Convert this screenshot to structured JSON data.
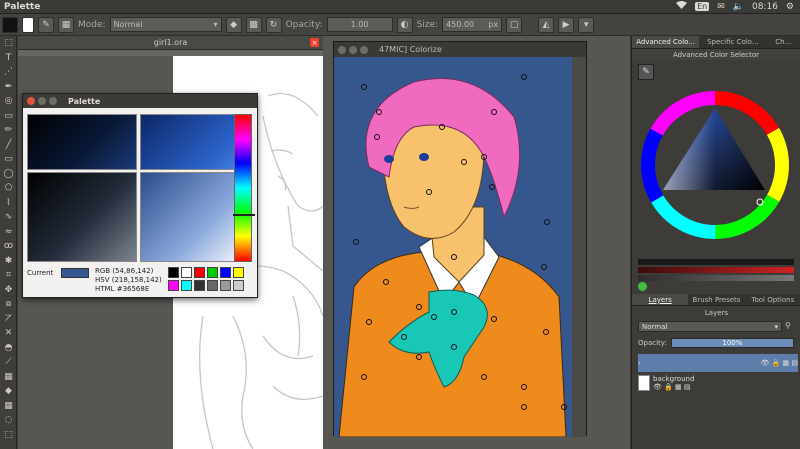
{
  "app": {
    "title": "Palette"
  },
  "system": {
    "lang": "En",
    "time": "08:16"
  },
  "tool_options": {
    "mode_label": "Mode:",
    "mode_value": "Normal",
    "opacity_label": "Opacity:",
    "opacity_value": "1.00",
    "size_label": "Size:",
    "size_value": "450.00",
    "size_unit": "px"
  },
  "document": {
    "tab": "girl1.ora"
  },
  "colorize": {
    "title": "47MIC] Colorize"
  },
  "palette": {
    "title": "Palette",
    "current_label": "Current",
    "current_color": "#36568e",
    "rgb": "RGB  (54,86,142)",
    "hsv": "HSV  (218,158,142)",
    "html": "HTML  #36568E",
    "swatches": [
      "#000000",
      "#ffffff",
      "#ff0000",
      "#00cc00",
      "#0000ff",
      "#ffff00",
      "#ff00ff",
      "#00ffff",
      "#333333",
      "#666666",
      "#999999",
      "#cccccc"
    ]
  },
  "dock": {
    "tabs": [
      "Advanced Colo...",
      "Specific Colo...",
      "Ch..."
    ],
    "color_header": "Advanced Color Selector",
    "layer_tabs": [
      "Layers",
      "Brush Presets",
      "Tool Options"
    ],
    "layers_header": "Layers",
    "blend_mode": "Normal",
    "opacity_label": "Opacity:",
    "opacity_value": "100%",
    "layers": [
      {
        "name": ""
      },
      {
        "name": "background"
      }
    ]
  },
  "icons": [
    "wifi-icon",
    "mail-icon",
    "volume-icon",
    "settings-icon"
  ]
}
